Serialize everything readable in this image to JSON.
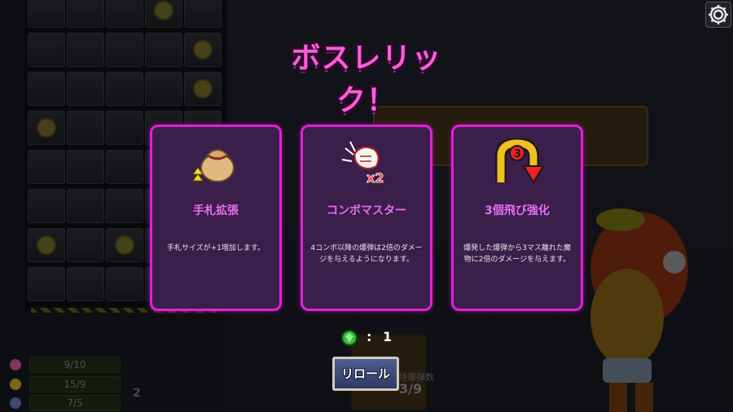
{
  "title": "ボスレリック！",
  "relic_cards": [
    {
      "icon": "money-bag-icon",
      "name": "手札拡張",
      "description": "手札サイズが+1増加します。"
    },
    {
      "icon": "fist-x2-icon",
      "name": "コンボマスター",
      "description": "4コンボ以降の爆弾は2倍のダメージを与えるようになります。"
    },
    {
      "icon": "u-turn-arrow-3-icon",
      "name": "3個飛び強化",
      "description": "爆発した爆弾から3マス離れた魔物に2倍のダメージを与えます。"
    }
  ],
  "reroll": {
    "gem_icon": "green-gem-icon",
    "colon": ":",
    "count": "1",
    "button_label": "リロール"
  },
  "settings_icon": "gear-icon",
  "background": {
    "stats": [
      {
        "icon": "heart-icon",
        "value": "9/10",
        "color": "#c0508a"
      },
      {
        "icon": "coin-icon",
        "value": "15/9",
        "color": "#b8a030"
      },
      {
        "icon": "mana-icon",
        "value": "7/5",
        "color": "#6070b0"
      }
    ],
    "bomb_stock_label": "所持爆弾数",
    "bomb_stock_value": "3/9",
    "mini_counter": "2"
  },
  "colors": {
    "card_border": "#e21fd9",
    "card_bg": "#3a1f4a",
    "title": "#ff5cd8",
    "card_title": "#e86cf2"
  }
}
